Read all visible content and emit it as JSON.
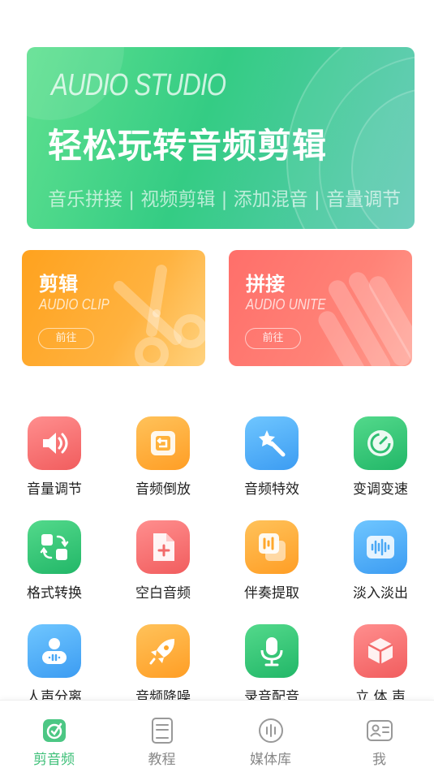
{
  "hero": {
    "english_title": "AUDIO STUDIO",
    "title": "轻松玩转音频剪辑",
    "subtitle": "音乐拼接 | 视频剪辑 | 添加混音 | 音量调节"
  },
  "cards": [
    {
      "title": "剪辑",
      "english": "AUDIO CLIP",
      "button": "前往",
      "color": "#ffa21e",
      "icon": "scissors-icon"
    },
    {
      "title": "拼接",
      "english": "AUDIO UNITE",
      "button": "前往",
      "color": "#ff6f6a",
      "icon": "stripes-icon"
    }
  ],
  "tools": [
    {
      "label": "音量调节",
      "icon": "speaker-icon",
      "color": "red"
    },
    {
      "label": "音频倒放",
      "icon": "reverse-icon",
      "color": "orange"
    },
    {
      "label": "音频特效",
      "icon": "magic-wand-icon",
      "color": "blue"
    },
    {
      "label": "变调变速",
      "icon": "speedometer-icon",
      "color": "green"
    },
    {
      "label": "格式转换",
      "icon": "format-convert-icon",
      "color": "green"
    },
    {
      "label": "空白音频",
      "icon": "blank-file-icon",
      "color": "red"
    },
    {
      "label": "伴奏提取",
      "icon": "accompaniment-icon",
      "color": "orange"
    },
    {
      "label": "淡入淡出",
      "icon": "waveform-icon",
      "color": "blue"
    },
    {
      "label": "人声分离",
      "icon": "person-voice-icon",
      "color": "blue"
    },
    {
      "label": "音频降噪",
      "icon": "rocket-icon",
      "color": "orange"
    },
    {
      "label": "录音配音",
      "icon": "microphone-icon",
      "color": "green"
    },
    {
      "label": "立 体 声",
      "icon": "cube-icon",
      "color": "red"
    }
  ],
  "nav": [
    {
      "label": "剪音频",
      "icon": "audio-edit-icon",
      "active": true
    },
    {
      "label": "教程",
      "icon": "book-icon",
      "active": false
    },
    {
      "label": "媒体库",
      "icon": "media-library-icon",
      "active": false
    },
    {
      "label": "我",
      "icon": "profile-card-icon",
      "active": false
    }
  ],
  "colors": {
    "accent": "#3cbf77",
    "nav_inactive": "#888888"
  }
}
